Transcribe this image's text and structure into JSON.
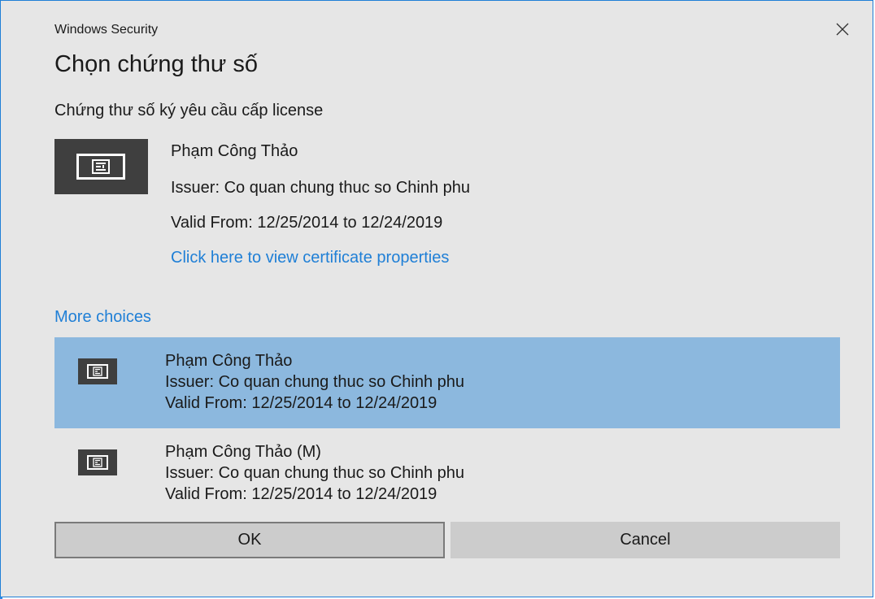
{
  "window": {
    "app_title": "Windows Security",
    "close_icon": "close-icon"
  },
  "dialog": {
    "title": "Chọn chứng thư số",
    "subtitle": "Chứng thư số ký yêu cầu cấp license"
  },
  "primary_cert": {
    "icon": "certificate-icon",
    "name": "Phạm Công Thảo",
    "issuer": "Issuer: Co quan chung thuc so Chinh phu",
    "valid": "Valid From: 12/25/2014 to 12/24/2019",
    "view_properties_link": "Click here to view certificate properties"
  },
  "more_choices": {
    "label": "More choices",
    "items": [
      {
        "icon": "certificate-icon",
        "name": "Phạm Công Thảo",
        "issuer": "Issuer: Co quan chung thuc so Chinh phu",
        "valid": "Valid From: 12/25/2014 to 12/24/2019",
        "selected": true
      },
      {
        "icon": "certificate-icon",
        "name": "Phạm Công Thảo (M)",
        "issuer": "Issuer: Co quan chung thuc so Chinh phu",
        "valid": "Valid From: 12/25/2014 to 12/24/2019",
        "selected": false
      }
    ]
  },
  "buttons": {
    "ok": "OK",
    "cancel": "Cancel"
  },
  "colors": {
    "dialog_bg": "#e6e6e6",
    "accent_link": "#1f7fd6",
    "selected_row": "#8cb8de",
    "icon_bg": "#3f3f3f",
    "button_bg": "#cccccc"
  }
}
